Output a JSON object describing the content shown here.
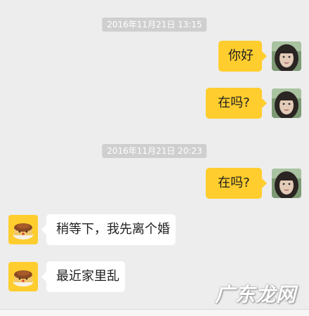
{
  "messages": {
    "ts1": "2016年11月21日 13:15",
    "msg1": "你好",
    "msg2": "在吗?",
    "ts2": "2016年11月21日 20:23",
    "msg3": "在吗?",
    "reply1": "稍等下，我先离个婚",
    "reply2": "最近家里乱"
  },
  "watermark": "广东龙网",
  "colors": {
    "background": "#ededed",
    "outgoing_bubble": "#ffcd2e",
    "incoming_bubble": "#ffffff",
    "timestamp_pill": "#cfcfcf",
    "contact_avatar": "#ffcd2e"
  },
  "icons": {
    "self_avatar": "selfie-avatar-icon",
    "contact_avatar": "pudding-cake-avatar-icon"
  }
}
